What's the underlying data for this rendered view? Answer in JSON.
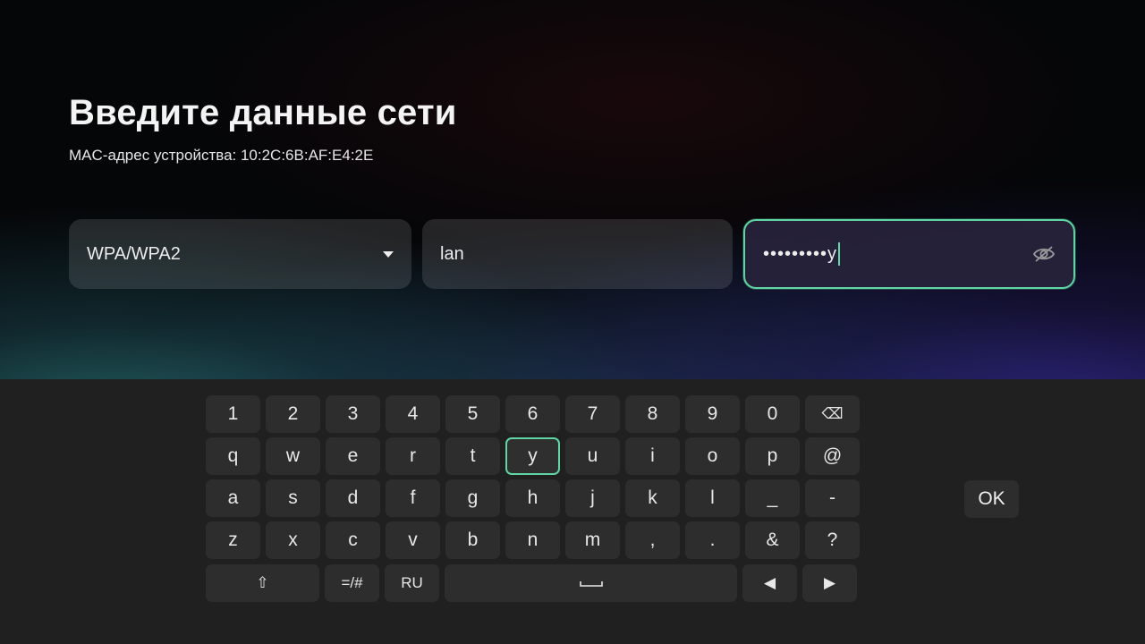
{
  "header": {
    "title": "Введите данные сети",
    "mac_text": "MAC-адрес устройства: 10:2C:6B:AF:E4:2E"
  },
  "fields": {
    "security": {
      "value": "WPA/WPA2",
      "icon": "dropdown-arrow-icon"
    },
    "ssid": {
      "value": "lan"
    },
    "password": {
      "masked": "•••••••••",
      "last_char": "y",
      "icon": "eye-off-icon",
      "focused": true
    }
  },
  "keyboard": {
    "rows": [
      [
        "1",
        "2",
        "3",
        "4",
        "5",
        "6",
        "7",
        "8",
        "9",
        "0",
        "⌫"
      ],
      [
        "q",
        "w",
        "e",
        "r",
        "t",
        "y",
        "u",
        "i",
        "o",
        "p",
        "@"
      ],
      [
        "a",
        "s",
        "d",
        "f",
        "g",
        "h",
        "j",
        "k",
        "l",
        "_",
        "-"
      ],
      [
        "z",
        "x",
        "c",
        "v",
        "b",
        "n",
        "m",
        ",",
        ".",
        "&",
        "?"
      ]
    ],
    "bottom": {
      "shift": "⇧",
      "symbols": "=/#",
      "language": "RU",
      "space": "space-icon",
      "left": "◀",
      "right": "▶"
    },
    "ok": "OK",
    "focused_key": "y",
    "accent_color": "#5fd6a4"
  }
}
